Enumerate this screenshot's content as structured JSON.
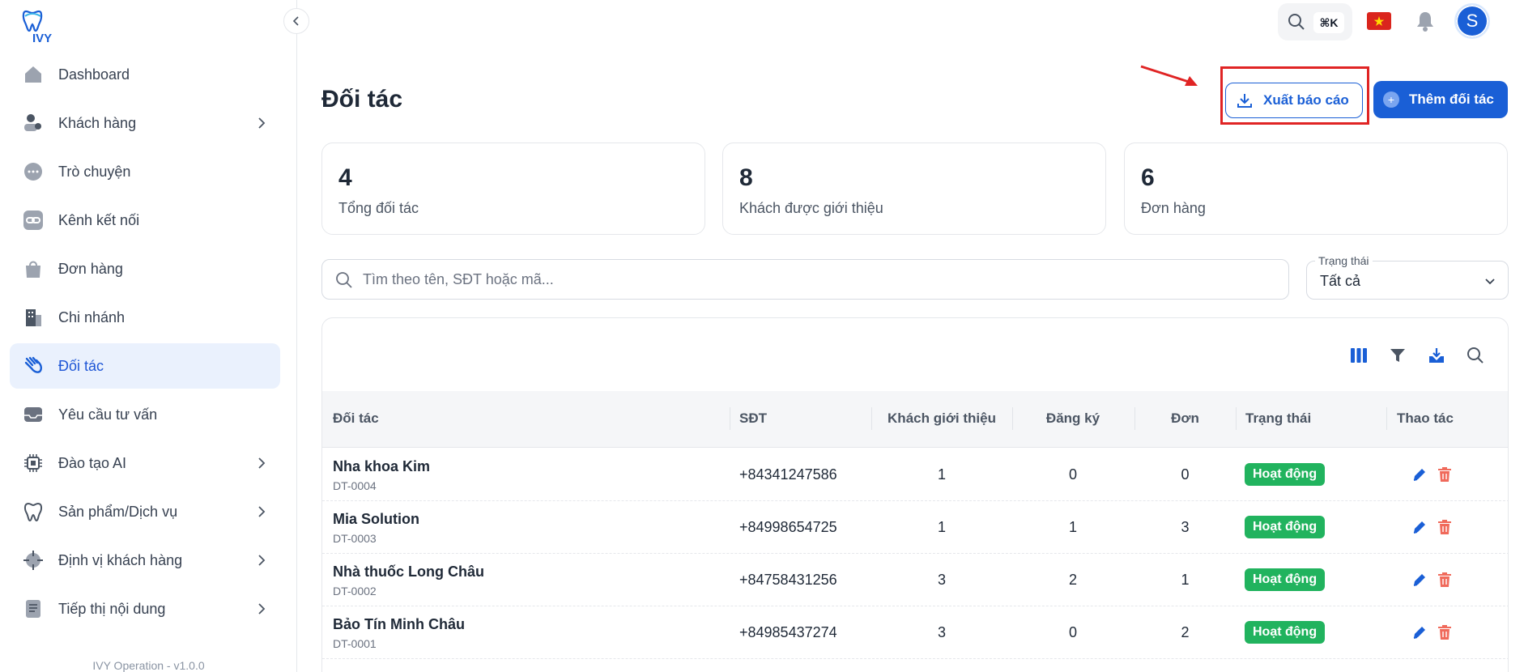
{
  "app": {
    "logo_text": "IVY",
    "version": "IVY Operation - v1.0.0"
  },
  "sidebar": {
    "items": [
      {
        "label": "Dashboard",
        "icon": "home-icon",
        "has_children": false,
        "active": false
      },
      {
        "label": "Khách hàng",
        "icon": "users-icon",
        "has_children": true,
        "active": false
      },
      {
        "label": "Trò chuyện",
        "icon": "chat-icon",
        "has_children": false,
        "active": false
      },
      {
        "label": "Kênh kết nối",
        "icon": "link-icon",
        "has_children": false,
        "active": false
      },
      {
        "label": "Đơn hàng",
        "icon": "shopping-bag-icon",
        "has_children": false,
        "active": false
      },
      {
        "label": "Chi nhánh",
        "icon": "building-icon",
        "has_children": false,
        "active": false
      },
      {
        "label": "Đối tác",
        "icon": "handshake-icon",
        "has_children": false,
        "active": true
      },
      {
        "label": "Yêu cầu tư vấn",
        "icon": "inbox-icon",
        "has_children": false,
        "active": false
      },
      {
        "label": "Đào tạo AI",
        "icon": "chip-icon",
        "has_children": true,
        "active": false
      },
      {
        "label": "Sản phẩm/Dịch vụ",
        "icon": "tooth-icon",
        "has_children": true,
        "active": false
      },
      {
        "label": "Định vị khách hàng",
        "icon": "crosshair-icon",
        "has_children": true,
        "active": false
      },
      {
        "label": "Tiếp thị nội dung",
        "icon": "document-icon",
        "has_children": true,
        "active": false
      }
    ]
  },
  "topbar": {
    "shortcut": "⌘K",
    "avatar_initial": "S",
    "language_flag": "vietnam-flag-icon"
  },
  "header": {
    "title": "Đối tác",
    "export_label": "Xuất báo cáo",
    "add_label": "Thêm đối tác"
  },
  "stats": [
    {
      "value": "4",
      "label": "Tổng đối tác"
    },
    {
      "value": "8",
      "label": "Khách được giới thiệu"
    },
    {
      "value": "6",
      "label": "Đơn hàng"
    }
  ],
  "filters": {
    "search_placeholder": "Tìm theo tên, SĐT hoặc mã...",
    "status_label": "Trạng thái",
    "status_value": "Tất cả"
  },
  "table": {
    "columns": [
      "Đối tác",
      "SĐT",
      "Khách giới thiệu",
      "Đăng ký",
      "Đơn",
      "Trạng thái",
      "Thao tác"
    ],
    "rows": [
      {
        "name": "Nha khoa Kim",
        "code": "DT-0004",
        "phone": "+84341247586",
        "referred": "1",
        "registered": "0",
        "orders": "0",
        "status": "Hoạt động"
      },
      {
        "name": "Mia Solution",
        "code": "DT-0003",
        "phone": "+84998654725",
        "referred": "1",
        "registered": "1",
        "orders": "3",
        "status": "Hoạt động"
      },
      {
        "name": "Nhà thuốc Long Châu",
        "code": "DT-0002",
        "phone": "+84758431256",
        "referred": "3",
        "registered": "2",
        "orders": "1",
        "status": "Hoạt động"
      },
      {
        "name": "Bảo Tín Minh Châu",
        "code": "DT-0001",
        "phone": "+84985437274",
        "referred": "3",
        "registered": "0",
        "orders": "2",
        "status": "Hoạt động"
      }
    ]
  },
  "colors": {
    "primary": "#1a5fd6",
    "active_bg": "#eaf1fd",
    "success": "#21b35e",
    "danger": "#e02424"
  }
}
